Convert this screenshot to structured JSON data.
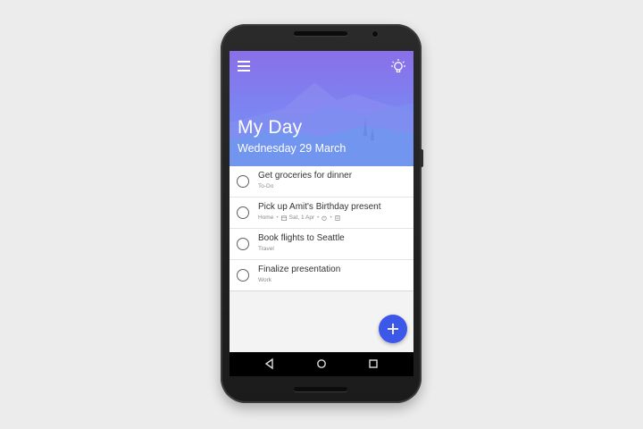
{
  "header": {
    "title": "My Day",
    "date": "Wednesday 29 March",
    "menu_icon": "hamburger-menu-icon",
    "suggestions_icon": "lightbulb-icon",
    "gradient_top": "#8a6fe8",
    "gradient_bottom": "#6a8ff2"
  },
  "tasks": [
    {
      "title": "Get groceries for dinner",
      "list": "To-Do"
    },
    {
      "title": "Pick up Amit's Birthday present",
      "list": "Home",
      "due": "Sat, 1 Apr",
      "has_reminder": true,
      "has_note": true
    },
    {
      "title": "Book flights to Seattle",
      "list": "Travel"
    },
    {
      "title": "Finalize presentation",
      "list": "Work"
    }
  ],
  "fab": {
    "icon": "plus-icon",
    "color": "#3d57e8"
  },
  "navbar": {
    "back_icon": "back-triangle-icon",
    "home_icon": "home-circle-icon",
    "recents_icon": "recents-square-icon"
  }
}
